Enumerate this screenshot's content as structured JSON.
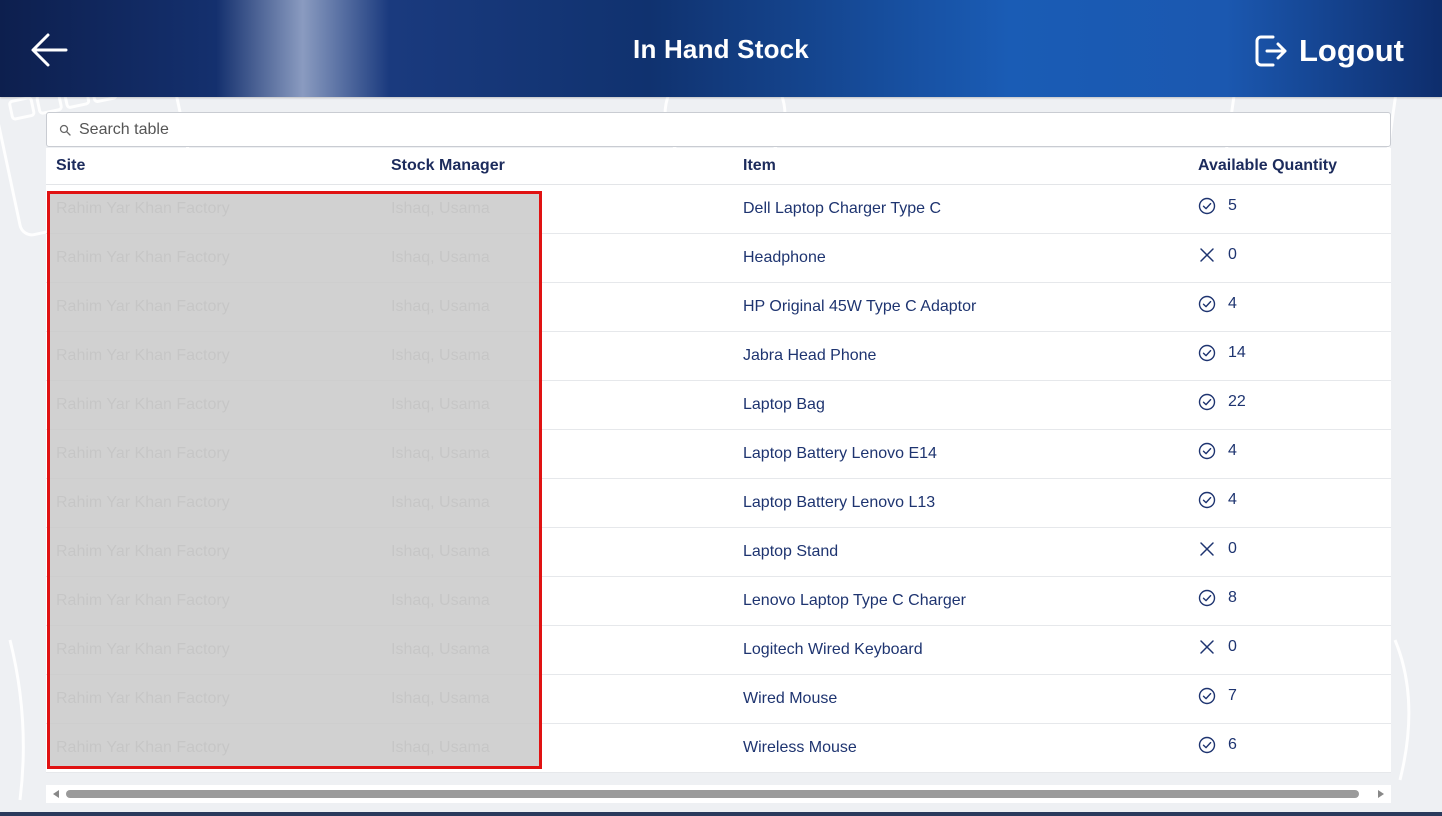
{
  "header": {
    "title": "In Hand Stock",
    "logout_label": "Logout",
    "back_icon": "arrow-left-icon",
    "logout_icon": "logout-icon"
  },
  "search": {
    "placeholder": "Search table",
    "value": ""
  },
  "table": {
    "columns": [
      "Site",
      "Stock Manager",
      "Item",
      "Available Quantity"
    ],
    "rows": [
      {
        "site": "Rahim Yar Khan Factory",
        "manager": "Ishaq, Usama",
        "item": "Dell Laptop Charger Type C",
        "qty": "5",
        "status": "check"
      },
      {
        "site": "Rahim Yar Khan Factory",
        "manager": "Ishaq, Usama",
        "item": "Headphone",
        "qty": "0",
        "status": "cross"
      },
      {
        "site": "Rahim Yar Khan Factory",
        "manager": "Ishaq, Usama",
        "item": "HP Original 45W Type C Adaptor",
        "qty": "4",
        "status": "check"
      },
      {
        "site": "Rahim Yar Khan Factory",
        "manager": "Ishaq, Usama",
        "item": "Jabra Head Phone",
        "qty": "14",
        "status": "check"
      },
      {
        "site": "Rahim Yar Khan Factory",
        "manager": "Ishaq, Usama",
        "item": "Laptop Bag",
        "qty": "22",
        "status": "check"
      },
      {
        "site": "Rahim Yar Khan Factory",
        "manager": "Ishaq, Usama",
        "item": "Laptop Battery Lenovo E14",
        "qty": "4",
        "status": "check"
      },
      {
        "site": "Rahim Yar Khan Factory",
        "manager": "Ishaq, Usama",
        "item": "Laptop Battery Lenovo L13",
        "qty": "4",
        "status": "check"
      },
      {
        "site": "Rahim Yar Khan Factory",
        "manager": "Ishaq, Usama",
        "item": "Laptop Stand",
        "qty": "0",
        "status": "cross"
      },
      {
        "site": "Rahim Yar Khan Factory",
        "manager": "Ishaq, Usama",
        "item": "Lenovo Laptop Type C Charger",
        "qty": "8",
        "status": "check"
      },
      {
        "site": "Rahim Yar Khan Factory",
        "manager": "Ishaq, Usama",
        "item": "Logitech Wired Keyboard",
        "qty": "0",
        "status": "cross"
      },
      {
        "site": "Rahim Yar Khan Factory",
        "manager": "Ishaq, Usama",
        "item": "Wired Mouse",
        "qty": "7",
        "status": "check"
      },
      {
        "site": "Rahim Yar Khan Factory",
        "manager": "Ishaq, Usama",
        "item": "Wireless Mouse",
        "qty": "6",
        "status": "check"
      }
    ]
  },
  "colors": {
    "header_dark": "#0d1f4e",
    "header_blue": "#1a5cb5",
    "text_navy": "#1e3470",
    "redaction_border": "#e01212"
  }
}
